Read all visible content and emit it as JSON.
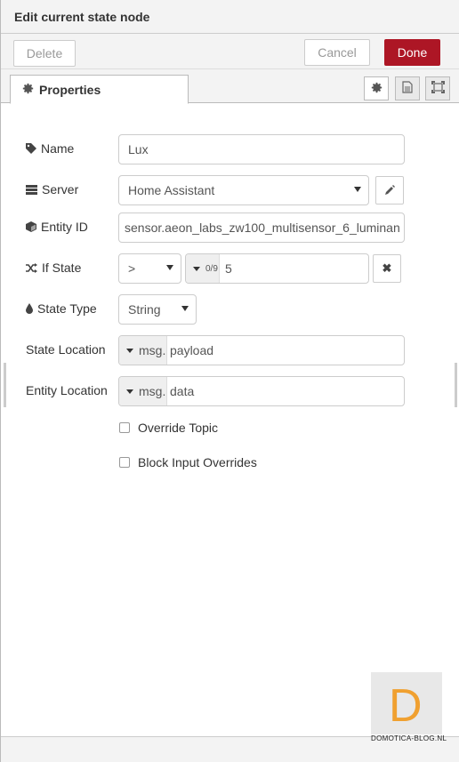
{
  "header": {
    "title": "Edit current state node"
  },
  "toolbar": {
    "delete_label": "Delete",
    "cancel_label": "Cancel",
    "done_label": "Done"
  },
  "tabs": [
    {
      "label": "Properties",
      "icon": "gear-icon"
    }
  ],
  "tab_buttons": [
    "gear-icon",
    "document-icon",
    "frame-icon"
  ],
  "form": {
    "name": {
      "label": "Name",
      "value": "Lux",
      "icon": "tag-icon"
    },
    "server": {
      "label": "Server",
      "value": "Home Assistant",
      "icon": "server-icon"
    },
    "entity_id": {
      "label": "Entity ID",
      "value": "sensor.aeon_labs_zw100_multisensor_6_luminan",
      "icon": "cube-icon"
    },
    "if_state": {
      "label": "If State",
      "operator": ">",
      "type_glyph": "0/9",
      "value": "5",
      "icon": "shuffle-icon"
    },
    "state_type": {
      "label": "State Type",
      "value": "String",
      "icon": "drop-icon"
    },
    "state_location": {
      "label": "State Location",
      "prefix": "msg.",
      "value": "payload"
    },
    "entity_location": {
      "label": "Entity Location",
      "prefix": "msg.",
      "value": "data"
    },
    "override_topic": {
      "label": "Override Topic",
      "checked": false
    },
    "block_input_overrides": {
      "label": "Block Input Overrides",
      "checked": false
    }
  },
  "watermark": {
    "letter": "D",
    "text": "DOMOTICA-BLOG.NL",
    "color": "#f0a030"
  },
  "colors": {
    "done": "#ad1625"
  }
}
